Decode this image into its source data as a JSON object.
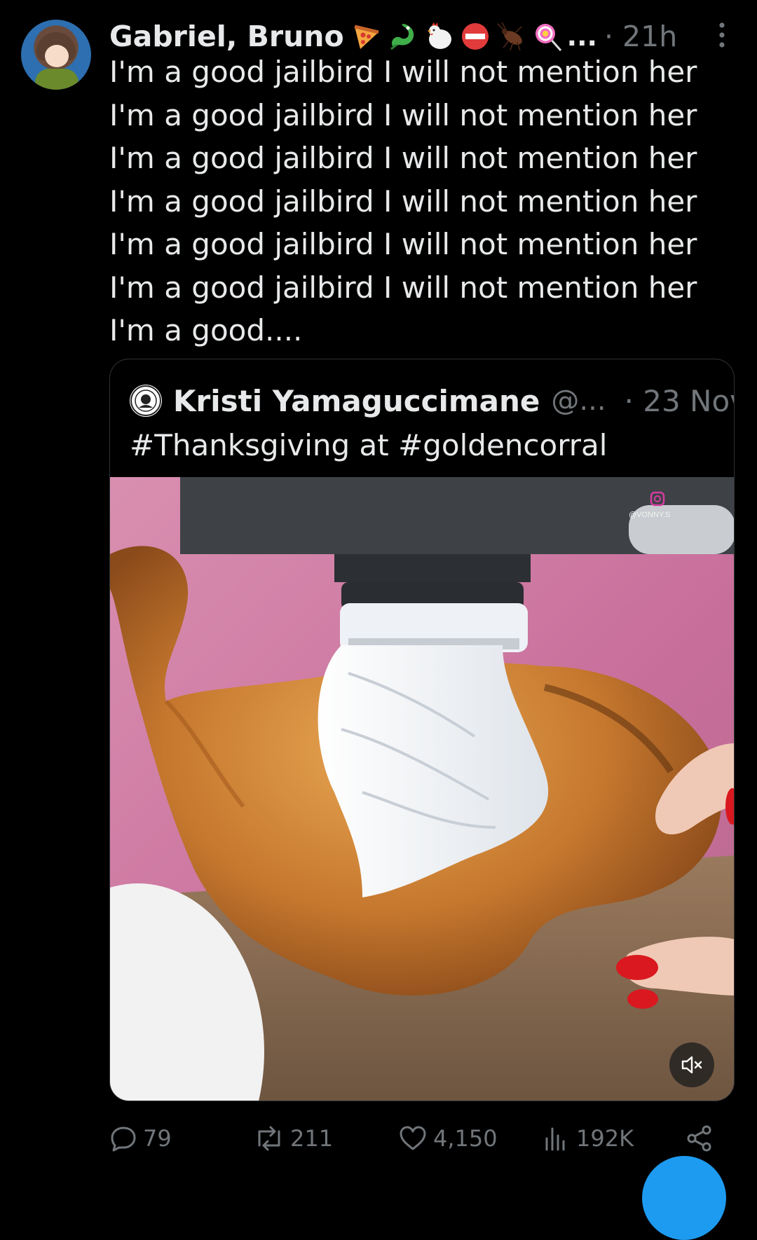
{
  "post": {
    "author": "Gabriel, Bruno",
    "emoji_icons": [
      "pizza-icon",
      "dragon-icon",
      "chicken-icon",
      "no-entry-icon",
      "cockroach-icon",
      "lollipop-icon"
    ],
    "name_overflow": "...",
    "time": "· 21h",
    "lines": [
      "I'm a good jailbird I will not mention her",
      "I'm a good jailbird I will not mention her",
      "I'm a good jailbird I will not mention her",
      "I'm a good jailbird I will not mention her",
      "I'm a good jailbird I will not mention her",
      "I'm a good jailbird I will not mention her",
      "I'm a good...."
    ]
  },
  "quote": {
    "author": "Kristi Yamaguccimane",
    "handle": "@...",
    "date": "· 23 Nov",
    "text": "#Thanksgiving at #goldencorral",
    "watermark": "@VONNY.S"
  },
  "actions": {
    "replies": "79",
    "reposts": "211",
    "likes": "4,150",
    "views": "192K"
  },
  "colors": {
    "background": "#000000",
    "text": "#e7e9ea",
    "muted": "#71767b",
    "border": "#2f3336",
    "accent": "#1d9bf0"
  }
}
